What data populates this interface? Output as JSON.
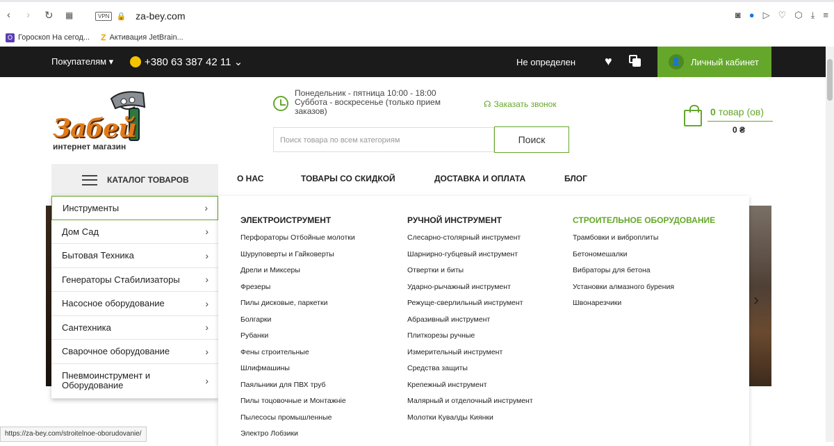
{
  "browser": {
    "url": "za-bey.com",
    "vpn": "VPN",
    "bookmarks": [
      "Гороскоп На сегод...",
      "Активация JetBrain..."
    ],
    "status_url": "https://za-bey.com/stroitelnoe-oborudovanie/"
  },
  "topbar": {
    "buyers": "Покупателям ▾",
    "phone": "+380 63 387 42 11 ⌄",
    "city": "Не определен",
    "account": "Личный кабинет"
  },
  "header": {
    "logo_text": "Забей",
    "logo_sub": "интернет магазин",
    "schedule_line1": "Понедельник - пятница 10:00 - 18:00",
    "schedule_line2": "Суббота - воскресенье (только прием заказов)",
    "callback": "Заказать звонок",
    "search_placeholder": "Поиск товара по всем категориям",
    "search_button": "Поиск",
    "cart_count": "0",
    "cart_count_suffix": "товар (ов)",
    "cart_sum": "0 ₴"
  },
  "nav": {
    "catalog": "КАТАЛОГ ТОВАРОВ",
    "items": [
      "О НАС",
      "ТОВАРЫ СО СКИДКОЙ",
      "ДОСТАВКА И ОПЛАТА",
      "БЛОГ"
    ]
  },
  "categories": [
    "Инструменты",
    "Дом Сад",
    "Бытовая Техника",
    "Генераторы Стабилизаторы",
    "Насосное оборудование",
    "Сантехника",
    "Сварочное оборудование",
    "Пневмоинструмент и Оборудование"
  ],
  "mega": {
    "columns": [
      {
        "title": "ЭЛЕКТРОИСТРУМЕНТ",
        "items": [
          "Перфораторы Отбойные молотки",
          "Шуруповерты и Гайковерты",
          "Дрели и Миксеры",
          "Фрезеры",
          "Пилы дисковые, паркетки",
          "Болгарки",
          "Рубанки",
          "Фены строительные",
          "Шлифмашины",
          "Паяльники для ПВХ труб",
          "Пилы тоцовочные и Монтажніе",
          "Пылесосы промышленные",
          "Электро Лобзики"
        ]
      },
      {
        "title": "РУЧНОЙ ИНСТРУМЕНТ",
        "items": [
          "Слесарно-столярный инструмент",
          "Шарнирно-губцевый инструмент",
          "Отвертки и биты",
          "Ударно-рычажный инструмент",
          "Режуще-сверлильный инструмент",
          "Абразивный инструмент",
          "Плиткорезы ручные",
          "Измерительный инструмент",
          "Средства защиты",
          "Крепежный инструмент",
          "Малярный и отделочный инструмент",
          "Молотки Кувалды Киянки"
        ]
      },
      {
        "title": "СТРОИТЕЛЬНОЕ ОБОРУДОВАНИЕ",
        "items": [
          "Трамбовки и виброплиты",
          "Бетономешалки",
          "Вибраторы для бетона",
          "Установки алмазного бурения",
          "Швонарезчики"
        ]
      }
    ]
  }
}
